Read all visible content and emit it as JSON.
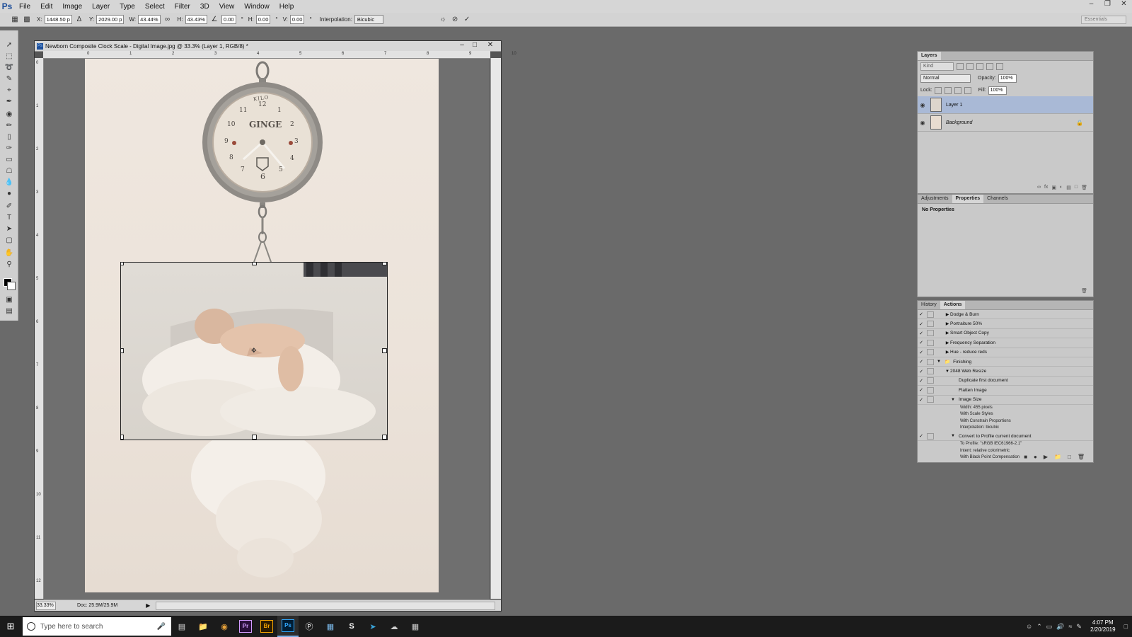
{
  "app": {
    "logo": "Ps",
    "menu": [
      "File",
      "Edit",
      "Image",
      "Layer",
      "Type",
      "Select",
      "Filter",
      "3D",
      "View",
      "Window",
      "Help"
    ]
  },
  "options_bar": {
    "x_label": "X:",
    "x_value": "1448.50 p",
    "y_label": "Y:",
    "y_value": "2029.00 p",
    "w_label": "W:",
    "w_value": "43.44%",
    "h_label": "H:",
    "h_value": "43.43%",
    "angle_value": "0.00",
    "deg": "°",
    "hskew_label": "H:",
    "hskew_value": "0.00",
    "vskew_label": "V:",
    "vskew_value": "0.00",
    "interp_label": "Interpolation:",
    "interp_value": "Bicubic",
    "workspace": "Essentials"
  },
  "document": {
    "title": "Newborn Composite Clock Scale - Digital Image.jpg @ 33.3% (Layer 1, RGB/8) *",
    "zoom": "33.33%",
    "doc_info": "Doc: 25.9M/25.9M",
    "ruler_top": [
      "0",
      "1",
      "2",
      "3",
      "4",
      "5",
      "6",
      "7",
      "8",
      "9",
      "10"
    ],
    "ruler_left": [
      "0",
      "1",
      "2",
      "3",
      "4",
      "5",
      "6",
      "7",
      "8",
      "9",
      "10",
      "11",
      "12"
    ],
    "clock_text": "GINGE",
    "clock_brand": "KILO",
    "clock_numbers": [
      "12",
      "1",
      "2",
      "3",
      "4",
      "5",
      "6",
      "7",
      "8",
      "9",
      "10",
      "11"
    ]
  },
  "layers_panel": {
    "tab": "Layers",
    "kind": "Kind",
    "blend_mode": "Normal",
    "opacity_label": "Opacity:",
    "opacity_value": "100%",
    "lock_label": "Lock:",
    "fill_label": "Fill:",
    "fill_value": "100%",
    "layers": [
      {
        "name": "Layer 1",
        "selected": true
      },
      {
        "name": "Background",
        "selected": false
      }
    ]
  },
  "properties_panel": {
    "tabs": [
      "Adjustments",
      "Properties",
      "Channels"
    ],
    "active": "Properties",
    "message": "No Properties"
  },
  "actions_panel": {
    "tabs": [
      "History",
      "Actions"
    ],
    "active": "Actions",
    "rows": [
      {
        "label": "Dodge & Burn"
      },
      {
        "label": "Portraiture 50%"
      },
      {
        "label": "Smart Object Copy"
      },
      {
        "label": "Frequency Separation"
      },
      {
        "label": "Hue - reduce reds"
      },
      {
        "label": "Finishing"
      },
      {
        "label": "2048 Web Resize"
      },
      {
        "label": "Duplicate first document"
      },
      {
        "label": "Flatten Image"
      },
      {
        "label": "Image Size"
      }
    ],
    "image_size_details": [
      "Width: 455 pixels",
      "With Scale Styles",
      "With Constrain Proportions",
      "Interpolation: bicubic"
    ],
    "convert_row": "Convert to Profile current document",
    "convert_details": [
      "To Profile: \"sRGB IEC61966-2.1\"",
      "Intent: relative colorimetric",
      "With Black Point Compensation"
    ]
  },
  "taskbar": {
    "search_placeholder": "Type here to search",
    "time": "4:07 PM",
    "date": "2/20/2019",
    "apps": [
      "Pr",
      "Br",
      "Ps"
    ]
  },
  "colors": {
    "workspace_bg": "#6a6a6a",
    "selected_layer": "#a9b9d6",
    "taskbar": "#1b1b1b"
  }
}
